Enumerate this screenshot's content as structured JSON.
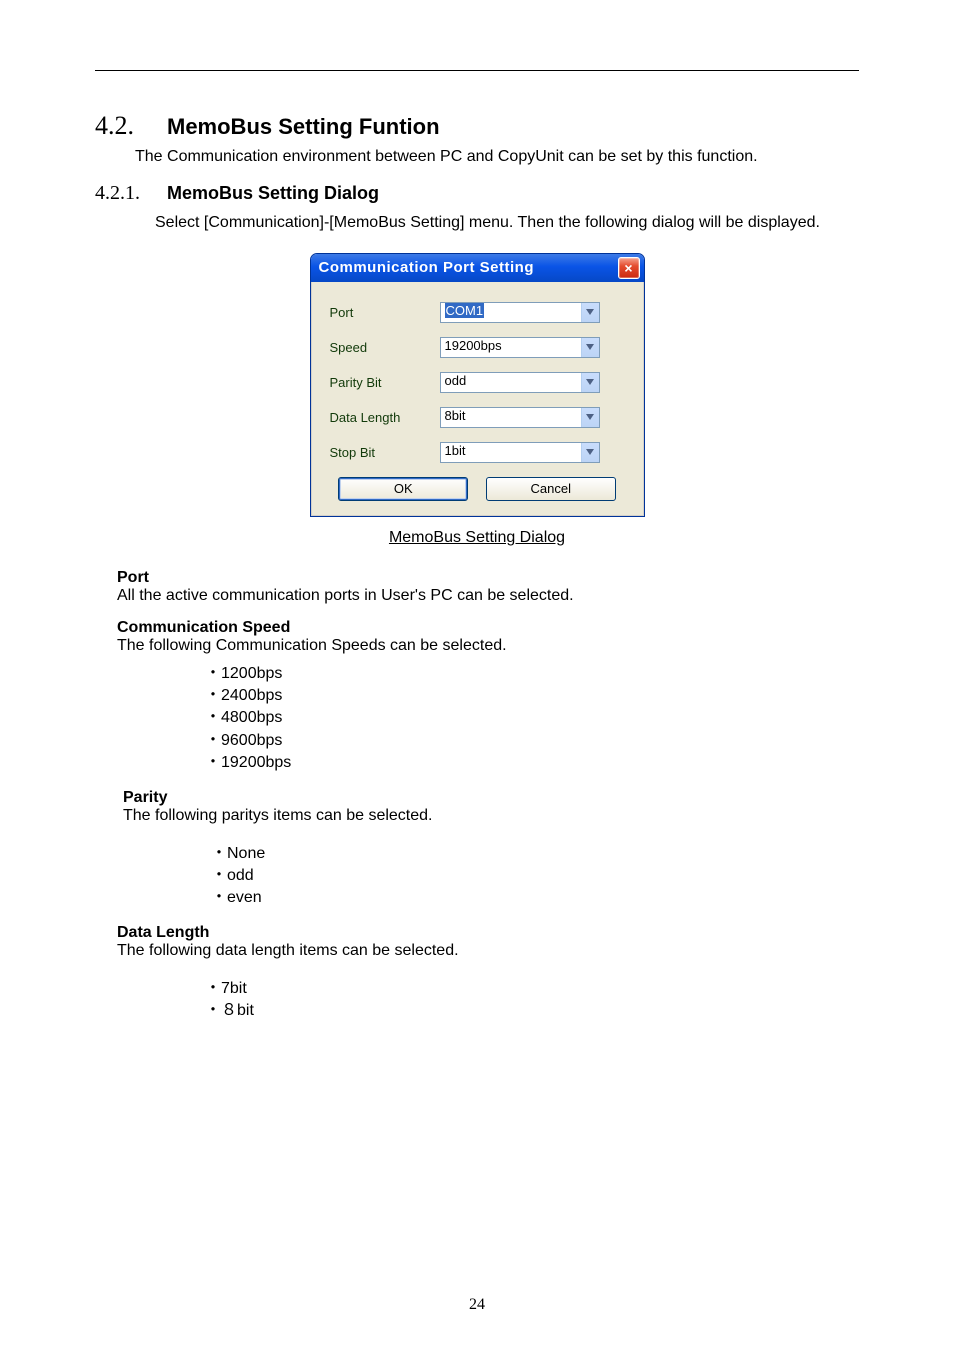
{
  "section": {
    "num": "4.2.",
    "title": "MemoBus Setting Funtion",
    "intro": "The Communication environment between PC and CopyUnit can be set by this function."
  },
  "subsection": {
    "num": "4.2.1.",
    "title": "MemoBus Setting Dialog",
    "intro": "Select [Communication]-[MemoBus Setting] menu. Then the following dialog will be displayed."
  },
  "dialog": {
    "title": "Communication Port Setting",
    "close": "×",
    "fields": {
      "port": {
        "label": "Port",
        "value": "COM1"
      },
      "speed": {
        "label": "Speed",
        "value": "19200bps"
      },
      "parity": {
        "label": "Parity Bit",
        "value": "odd"
      },
      "datalen": {
        "label": "Data Length",
        "value": "8bit"
      },
      "stopbit": {
        "label": "Stop Bit",
        "value": "1bit"
      }
    },
    "ok": "OK",
    "cancel": "Cancel"
  },
  "caption": "MemoBus Setting Dialog",
  "port": {
    "h": "Port",
    "p": "All the active communication ports in User's PC can be selected."
  },
  "speed": {
    "h": "Communication Speed",
    "p": "The following Communication Speeds can be selected.",
    "items": [
      "・1200bps",
      "・2400bps",
      "・4800bps",
      "・9600bps",
      "・19200bps"
    ]
  },
  "parity": {
    "h": "Parity",
    "p": "The following paritys items can be selected.",
    "items": [
      "・None",
      "・odd",
      "・even"
    ]
  },
  "datalen": {
    "h": "Data Length",
    "p": "The following data length items can be selected.",
    "items": [
      "・7bit",
      "・８bit"
    ]
  },
  "pagenum": "24"
}
